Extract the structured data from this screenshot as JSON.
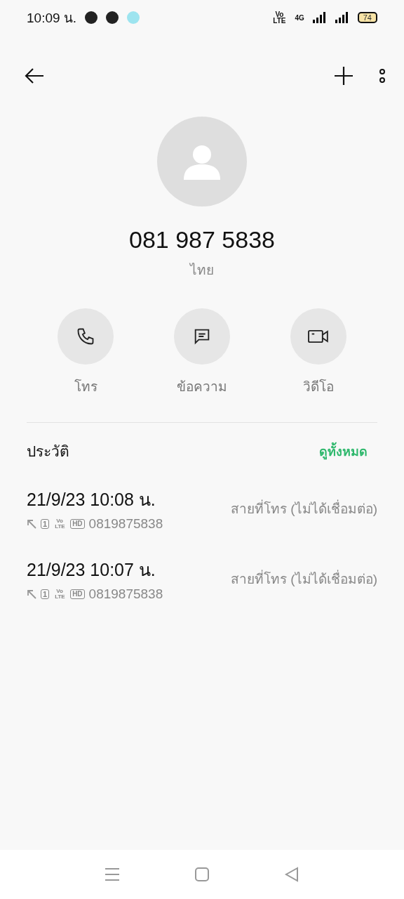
{
  "status_bar": {
    "time": "10:09 น.",
    "volte": "Vo LTE",
    "network": "4G",
    "battery": "74"
  },
  "contact": {
    "number": "081 987 5838",
    "country": "ไทย"
  },
  "actions": [
    {
      "kind": "call",
      "label": "โทร"
    },
    {
      "kind": "message",
      "label": "ข้อความ"
    },
    {
      "kind": "video",
      "label": "วิดีโอ"
    }
  ],
  "history": {
    "title": "ประวัติ",
    "view_all": "ดูทั้งหมด",
    "entries": [
      {
        "datetime": "21/9/23 10:08 น.",
        "sim": "1",
        "volte": "Vo LTE",
        "hd": "HD",
        "number": "0819875838",
        "status": "สายที่โทร (ไม่ได้เชื่อมต่อ)"
      },
      {
        "datetime": "21/9/23 10:07 น.",
        "sim": "1",
        "volte": "Vo LTE",
        "hd": "HD",
        "number": "0819875838",
        "status": "สายที่โทร (ไม่ได้เชื่อมต่อ)"
      }
    ]
  }
}
